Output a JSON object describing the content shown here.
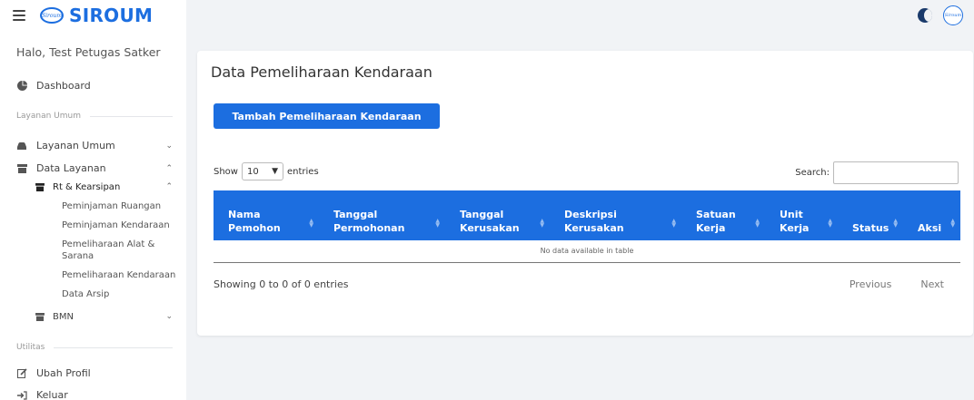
{
  "brand": {
    "name": "SIROUM",
    "logo_text": "Siroum"
  },
  "sidebar": {
    "greeting": "Halo, Test Petugas Satker",
    "dashboard": "Dashboard",
    "section_layanan": "Layanan Umum",
    "layanan_umum": "Layanan Umum",
    "data_layanan": "Data Layanan",
    "rt_kearsipan": "Rt & Kearsipan",
    "sub_items": [
      "Peminjaman Ruangan",
      "Peminjaman Kendaraan",
      "Pemeliharaan Alat &",
      "Sarana",
      "Pemeliharaan Kendaraan",
      "Data Arsip"
    ],
    "bmn": "BMN",
    "section_utilitas": "Utilitas",
    "ubah_profil": "Ubah Profil",
    "keluar": "Keluar"
  },
  "main": {
    "title": "Data Pemeliharaan Kendaraan",
    "add_button": "Tambah Pemeliharaan Kendaraan",
    "show_label": "Show",
    "entries_value": "10",
    "entries_label": "entries",
    "search_label": "Search:",
    "columns": [
      "Nama\nPemohon",
      "Tanggal\nPermohonan",
      "Tanggal\nKerusakan",
      "Deskripsi\nKerusakan",
      "Satuan\nKerja",
      "Unit\nKerja",
      "Status",
      "Aksi"
    ],
    "empty_message": "No data available in table",
    "info": "Showing 0 to 0 of 0 entries",
    "prev": "Previous",
    "next": "Next"
  },
  "icons": {
    "menu": "hamburger-icon",
    "theme": "moon-icon",
    "dashboard": "pie-chart-icon",
    "layanan": "car-icon",
    "archive": "archive-icon",
    "edit": "edit-icon",
    "logout": "logout-icon"
  },
  "colors": {
    "accent": "#1c6ee0",
    "background": "#f1f3f6"
  }
}
